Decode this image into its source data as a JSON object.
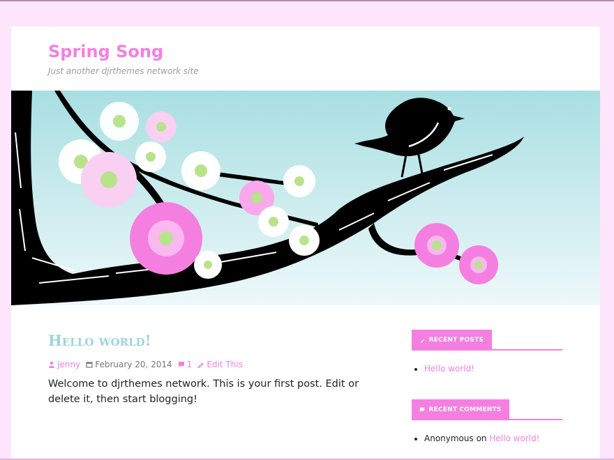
{
  "site": {
    "title": "Spring Song",
    "description": "Just another djrthemes network site"
  },
  "header_image": {
    "alt": "",
    "colors": {
      "sky_top": "#a8dfe2",
      "sky_bottom": "#eef8fa",
      "branch": "#000000",
      "blossom_pink": "#f57fe0",
      "blossom_light": "#f9d0f2",
      "blossom_white": "#ffffff",
      "stamen": "#b8e38a"
    }
  },
  "post": {
    "title": "Hello world!",
    "author": "Jenny",
    "date": "February 20, 2014",
    "comments": "1",
    "edit": "Edit This",
    "content": "Welcome to djrthemes network. This is your first post. Edit or delete it, then start blogging!"
  },
  "sidebar": {
    "recent_posts": {
      "title": "RECENT POSTS",
      "items": [
        {
          "label": "Hello world!"
        }
      ]
    },
    "recent_comments": {
      "title": "RECENT COMMENTS",
      "items": [
        {
          "author": "Anonymous",
          "on": "on",
          "post": "Hello world!"
        }
      ]
    }
  },
  "colors": {
    "accent": "#f57fe0",
    "page_bg": "#fde6fb",
    "title_blue": "#9bd5df"
  }
}
